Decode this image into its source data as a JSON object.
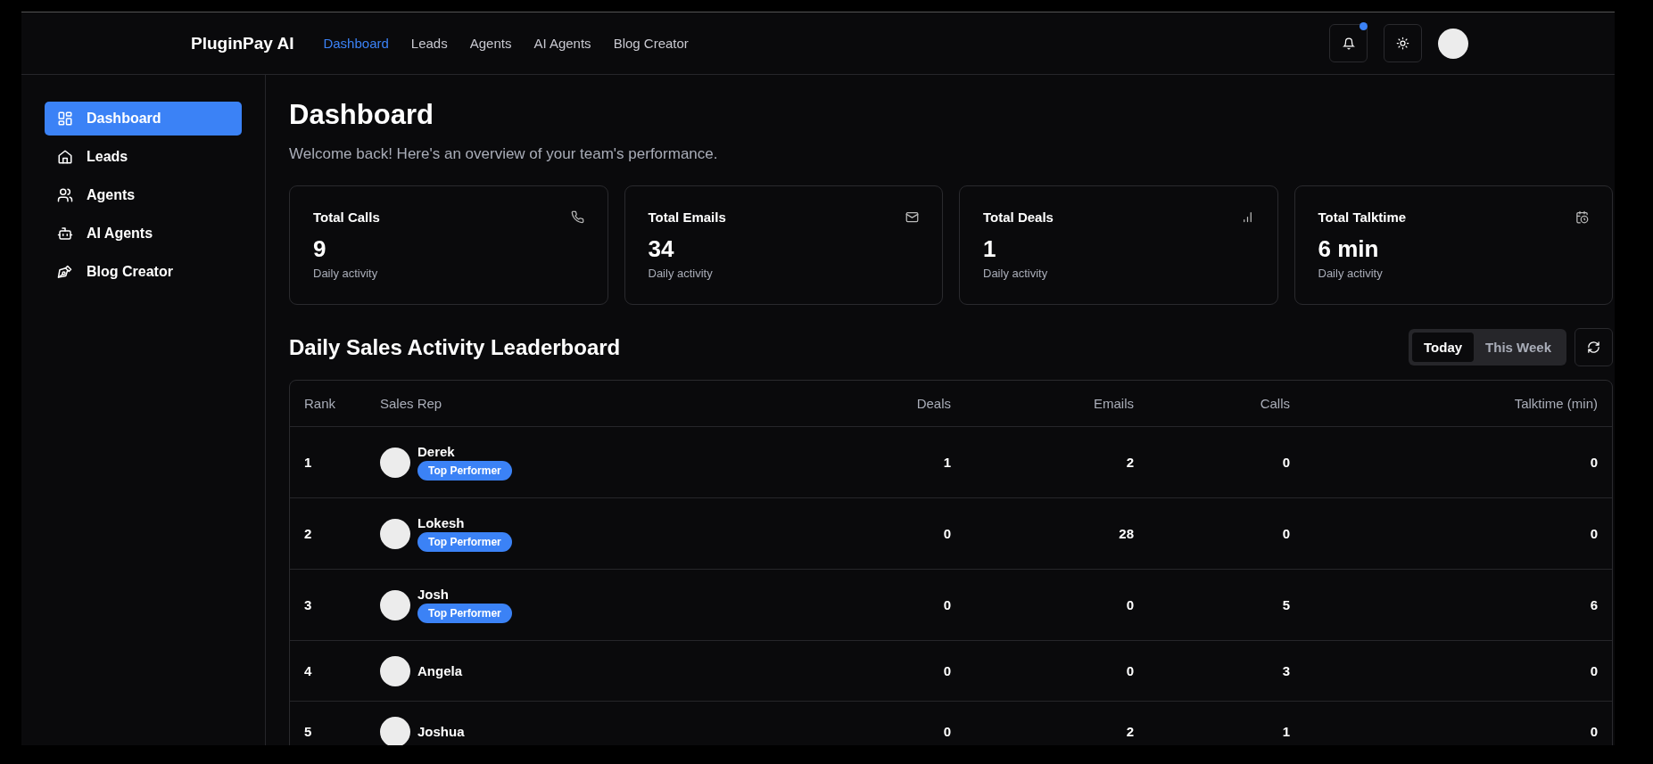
{
  "header": {
    "brand": "PluginPay AI",
    "nav": [
      {
        "label": "Dashboard",
        "selected": true
      },
      {
        "label": "Leads",
        "selected": false
      },
      {
        "label": "Agents",
        "selected": false
      },
      {
        "label": "AI Agents",
        "selected": false
      },
      {
        "label": "Blog Creator",
        "selected": false
      }
    ],
    "notification_unread": true
  },
  "sidebar": {
    "items": [
      {
        "label": "Dashboard",
        "kind": "grid",
        "selected": true
      },
      {
        "label": "Leads",
        "kind": "home",
        "selected": false
      },
      {
        "label": "Agents",
        "kind": "users",
        "selected": false
      },
      {
        "label": "AI Agents",
        "kind": "bot",
        "selected": false
      },
      {
        "label": "Blog Creator",
        "kind": "pen",
        "selected": false
      }
    ]
  },
  "page": {
    "title": "Dashboard",
    "subtitle": "Welcome back! Here's an overview of your team's performance."
  },
  "stats": [
    {
      "label": "Total Calls",
      "value": "9",
      "caption": "Daily activity",
      "kind": "phone"
    },
    {
      "label": "Total Emails",
      "value": "34",
      "caption": "Daily activity",
      "kind": "mail"
    },
    {
      "label": "Total Deals",
      "value": "1",
      "caption": "Daily activity",
      "kind": "bars"
    },
    {
      "label": "Total Talktime",
      "value": "6 min",
      "caption": "Daily activity",
      "kind": "calendar-clock"
    }
  ],
  "leaderboard": {
    "title": "Daily Sales Activity Leaderboard",
    "periods": [
      {
        "label": "Today",
        "selected": true
      },
      {
        "label": "This Week",
        "selected": false
      }
    ],
    "columns": [
      "Rank",
      "Sales Rep",
      "Deals",
      "Emails",
      "Calls",
      "Talktime (min)"
    ],
    "rows": [
      {
        "rank": "1",
        "name": "Derek",
        "badge": "Top Performer",
        "deals": "1",
        "emails": "2",
        "calls": "0",
        "talktime": "0"
      },
      {
        "rank": "2",
        "name": "Lokesh",
        "badge": "Top Performer",
        "deals": "0",
        "emails": "28",
        "calls": "0",
        "talktime": "0"
      },
      {
        "rank": "3",
        "name": "Josh",
        "badge": "Top Performer",
        "deals": "0",
        "emails": "0",
        "calls": "5",
        "talktime": "6"
      },
      {
        "rank": "4",
        "name": "Angela",
        "deals": "0",
        "emails": "0",
        "calls": "3",
        "talktime": "0"
      },
      {
        "rank": "5",
        "name": "Joshua",
        "deals": "0",
        "emails": "2",
        "calls": "1",
        "talktime": "0"
      }
    ]
  }
}
